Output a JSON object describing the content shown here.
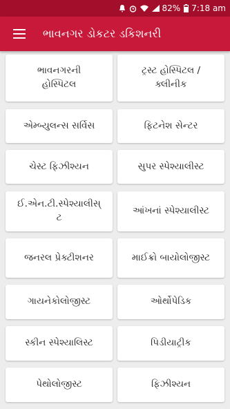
{
  "status_bar": {
    "battery": "82%",
    "time": "7:18 am"
  },
  "app_bar": {
    "title": "ભાવનગર ડોકટર ડકિશનરી",
    "menu_icon": "hamburger-menu-icon"
  },
  "categories": [
    {
      "label": "ભાવનગરની\nહોસ્પિટલ"
    },
    {
      "label": "ટ્રસ્ટ હોસ્પિટલ /\nક્લીનીક"
    },
    {
      "label": "એમ્બ્યુલન્સ સર્વિસ"
    },
    {
      "label": "ફિટનેશ સેન્ટર"
    },
    {
      "label": "ચેસ્ટ ફિઝીશ્યન"
    },
    {
      "label": "સુપર સ્પેશ્યાલીસ્ટ"
    },
    {
      "label": "ઈ.એન.ટી.સ્પેશ્યાલીસ્\nટ"
    },
    {
      "label": "આંખનાં સ્પેશ્યાલીસ્ટ"
    },
    {
      "label": "જનરલ પ્રેક્ટીશનર"
    },
    {
      "label": "માઈક્રો બાયોલોજીસ્ટ"
    },
    {
      "label": "ગાયનેકોલોજીસ્ટ"
    },
    {
      "label": "ઓર્થોપેડિક"
    },
    {
      "label": "સ્કીન સ્પેશ્યાલિસ્ટ"
    },
    {
      "label": "પિડીયાટ્રીક"
    },
    {
      "label": "પેથોલોજીસ્ટ"
    },
    {
      "label": "ફિઝીશ્યન"
    }
  ]
}
